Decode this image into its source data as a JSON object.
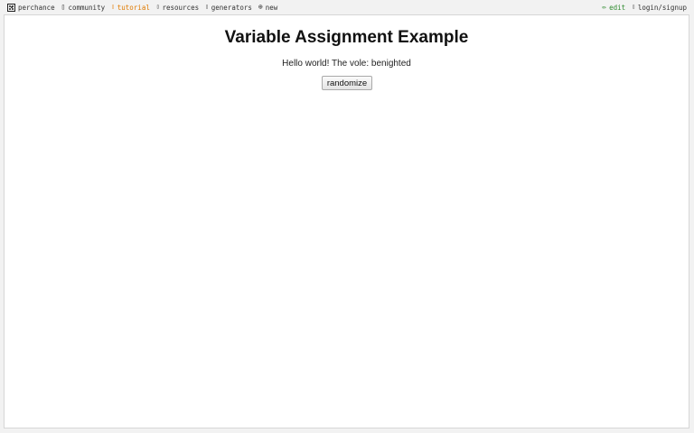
{
  "nav": {
    "left": [
      {
        "id": "perchance",
        "label": "perchance",
        "icon": "die-icon"
      },
      {
        "id": "community",
        "label": "community",
        "icon": "chat-icon"
      },
      {
        "id": "tutorial",
        "label": "tutorial",
        "icon": "book-icon",
        "active": true
      },
      {
        "id": "resources",
        "label": "resources",
        "icon": "toolbox-icon"
      },
      {
        "id": "generators",
        "label": "generators",
        "icon": "gear-icon"
      },
      {
        "id": "new",
        "label": "new",
        "icon": "plus-circle-icon"
      }
    ],
    "right": [
      {
        "id": "edit",
        "label": "edit",
        "icon": "pencil-icon"
      },
      {
        "id": "login",
        "label": "login/signup",
        "icon": "user-icon"
      }
    ]
  },
  "page": {
    "title": "Variable Assignment Example",
    "output": "Hello world! The vole: benighted",
    "randomize_label": "randomize"
  },
  "colors": {
    "active_nav": "#e07a00",
    "edit_link": "#2e8b2e",
    "frame_bg": "#ffffff",
    "outer_bg": "#f2f2f2"
  }
}
